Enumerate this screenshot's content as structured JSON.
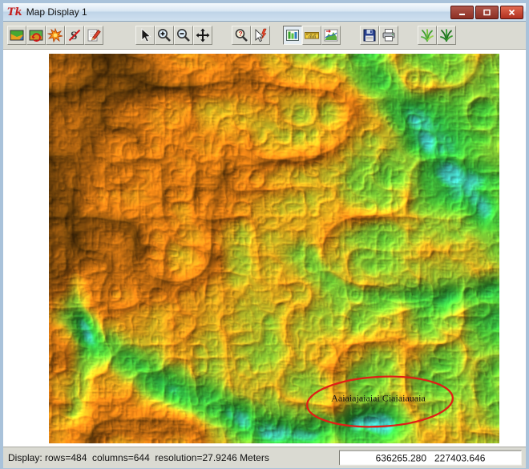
{
  "window": {
    "title": "Map Display 1",
    "tk_logo_text": "Tk"
  },
  "toolbar": {
    "icons": [
      "display-map-icon",
      "redraw-map-icon",
      "erase-display-icon",
      "cancel-draw-icon",
      "edit-pencil-icon",
      "pointer-icon",
      "zoom-in-icon",
      "zoom-out-icon",
      "pan-icon",
      "query-icon",
      "query-feature-icon",
      "overlay-panel-icon",
      "measure-ruler-icon",
      "profile-chart-icon",
      "save-floppy-icon",
      "print-icon",
      "grass-tools-icon",
      "grass-modules-icon"
    ]
  },
  "map": {
    "annotation_text": "Aaiaiajaiaiai Ciaiaiauaia"
  },
  "statusbar": {
    "display_info": "Display: rows=484  columns=644  resolution=27.9246 Meters",
    "coordinates": "636265.280   227403.646"
  },
  "colors": {
    "titlebar_top": "#f4f9fd",
    "titlebar_bottom": "#cfe0ef",
    "close_button": "#b03020",
    "annotation": "#df2016",
    "elevation_ramp": [
      "#3fc0b4",
      "#2fb040",
      "#4cb832",
      "#8cc431",
      "#d9a81e",
      "#df7d15",
      "#a85f10",
      "#6b400a",
      "#2a1804"
    ]
  }
}
